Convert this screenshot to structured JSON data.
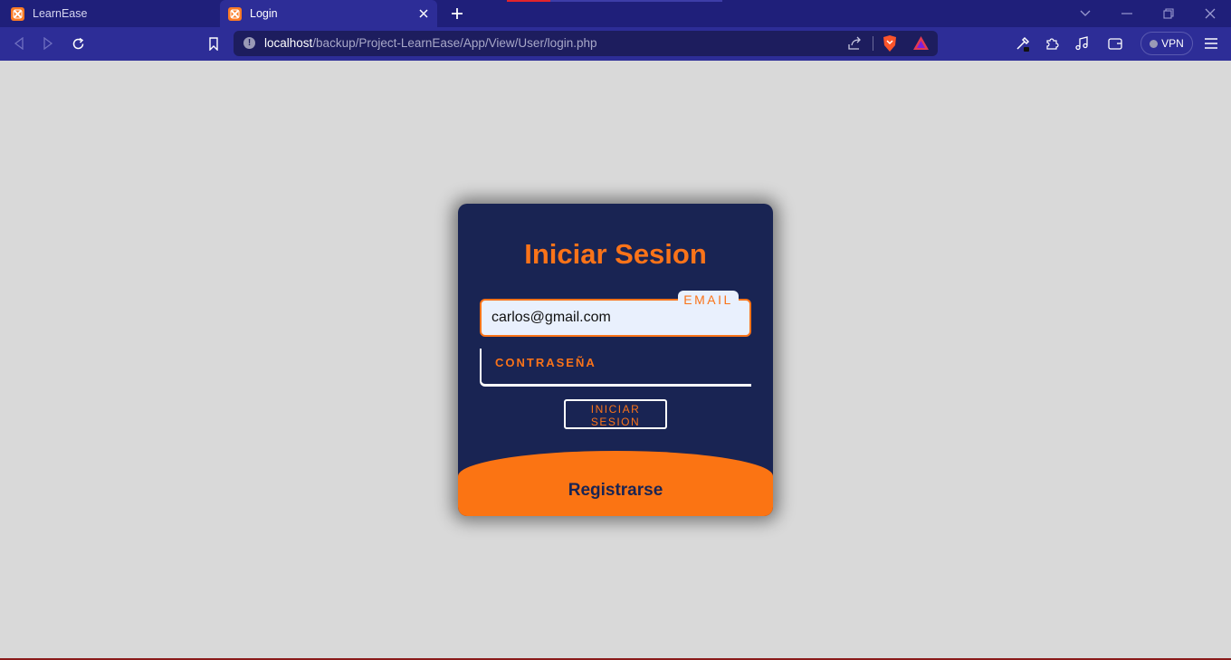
{
  "browser": {
    "tabs": [
      {
        "title": "LearnEase",
        "active": false
      },
      {
        "title": "Login",
        "active": true
      }
    ],
    "url": {
      "host": "localhost",
      "path": "/backup/Project-LearnEase/App/View/User/login.php"
    },
    "vpn_label": "VPN",
    "icons": {
      "back": "back-arrow-icon",
      "forward": "forward-arrow-icon",
      "reload": "reload-icon",
      "bookmark": "bookmark-icon",
      "share": "share-icon",
      "brave": "brave-shield-icon",
      "rewards": "brave-rewards-icon",
      "eyedropper": "eyedropper-icon",
      "extensions": "puzzle-icon",
      "media": "music-note-icon",
      "wallet": "wallet-icon",
      "menu": "hamburger-menu-icon"
    },
    "colors": {
      "tabstrip": "#1f1f7a",
      "toolbar": "#2d2d97",
      "urlbar": "#1d1d5e"
    }
  },
  "login": {
    "title": "Iniciar Sesion",
    "email": {
      "label": "EMAIL",
      "value": "carlos@gmail.com"
    },
    "password": {
      "label": "CONTRASEÑA",
      "value": ""
    },
    "submit_label": "INICIAR SESION",
    "register_label": "Registrarse",
    "colors": {
      "card": "#192453",
      "accent": "#fa7319",
      "input_bg": "#e9f0fd",
      "page_bg": "#d9d9d9"
    }
  }
}
